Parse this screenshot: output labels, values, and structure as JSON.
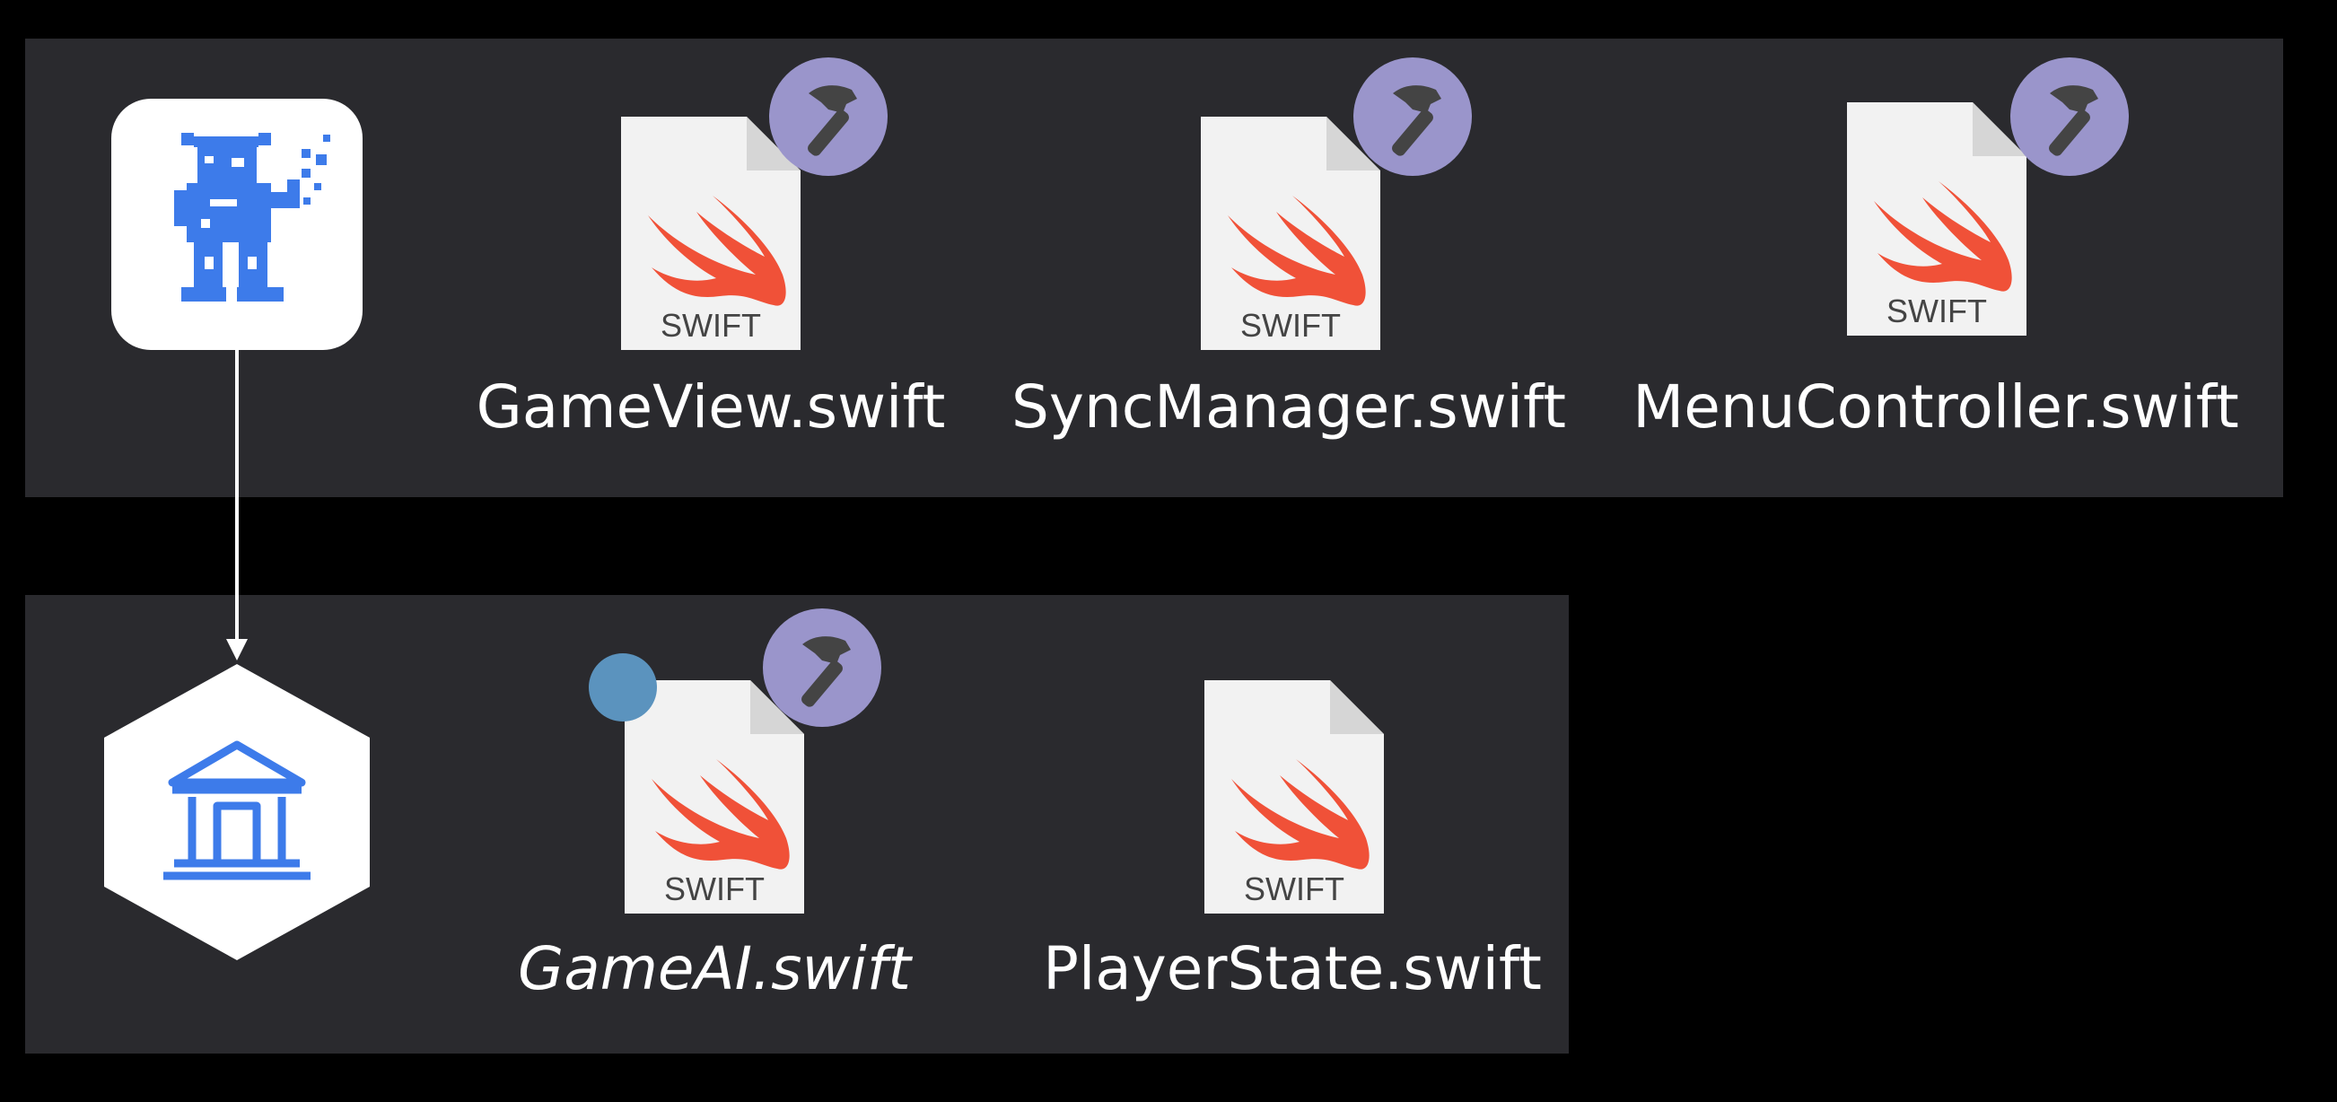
{
  "colors": {
    "background": "#000000",
    "panel": "#2a2a2e",
    "badge": "#9a95cb",
    "dot": "#5b93be",
    "accent_blue": "#3d7bea",
    "label": "#ffffff"
  },
  "app": {
    "icon": "pixel-robot-app-icon"
  },
  "library": {
    "icon": "bank-building-icon"
  },
  "top_row": {
    "files": [
      {
        "label": "GameView.swift",
        "file_type": "SWIFT",
        "badge": "hammer-icon"
      },
      {
        "label": "SyncManager.swift",
        "file_type": "SWIFT",
        "badge": "hammer-icon"
      },
      {
        "label": "MenuController.swift",
        "file_type": "SWIFT",
        "badge": "hammer-icon"
      }
    ]
  },
  "bottom_row": {
    "files": [
      {
        "label": "GameAI.swift",
        "file_type": "SWIFT",
        "badge": "hammer-icon",
        "marker": "blue-dot",
        "italic": true
      },
      {
        "label": "PlayerState.swift",
        "file_type": "SWIFT"
      }
    ]
  }
}
